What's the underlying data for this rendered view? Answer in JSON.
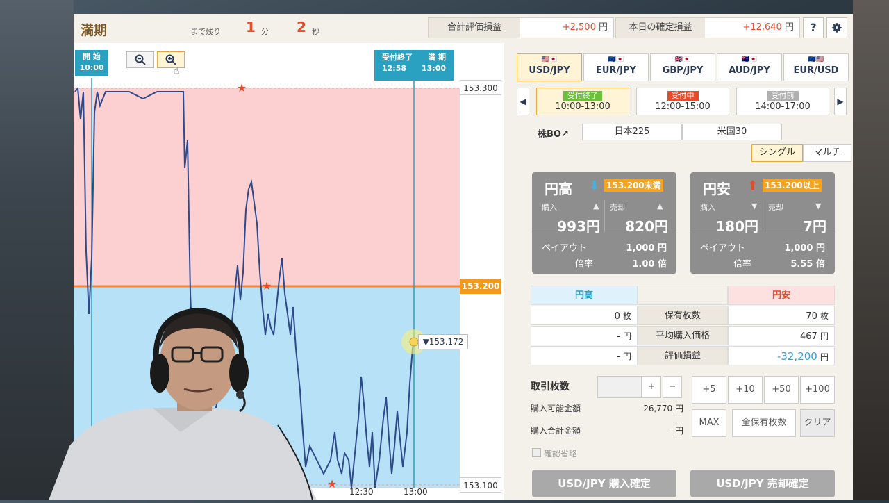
{
  "header": {
    "title": "満期",
    "remaining_label": "まで残り",
    "minutes": "1",
    "minutes_unit": "分",
    "seconds": "2",
    "seconds_unit": "秒",
    "total_pl_label": "合計評価損益",
    "total_pl_value": "+2,500",
    "total_pl_unit": "円",
    "today_pl_label": "本日の確定損益",
    "today_pl_value": "+12,640",
    "today_pl_unit": "円",
    "help_label": "?"
  },
  "chart": {
    "start_label": "開 始",
    "start_time": "10:00",
    "accept_end_label": "受付終了",
    "accept_end_time": "12:58",
    "expiry_label": "満 期",
    "expiry_time": "13:00",
    "upper_price": "153.300",
    "target_price": "153.200",
    "lower_price": "153.100",
    "current_price": "▼153.172",
    "x_tick_1": "12:30",
    "x_tick_2": "13:00",
    "colors": {
      "up_zone": "#fcd0d0",
      "down_zone": "#b6e1f7",
      "line": "#2e4a8c",
      "target": "#f0883a"
    }
  },
  "pairs": [
    {
      "name": "USD/JPY",
      "flags": "🇺🇸🇯🇵",
      "selected": true
    },
    {
      "name": "EUR/JPY",
      "flags": "🇪🇺🇯🇵",
      "selected": false
    },
    {
      "name": "GBP/JPY",
      "flags": "🇬🇧🇯🇵",
      "selected": false
    },
    {
      "name": "AUD/JPY",
      "flags": "🇦🇺🇯🇵",
      "selected": false
    },
    {
      "name": "EUR/USD",
      "flags": "🇪🇺🇺🇸",
      "selected": false
    }
  ],
  "slots": [
    {
      "status": "受付終了",
      "time": "10:00-13:00",
      "color": "#6bbf3a"
    },
    {
      "status": "受付中",
      "time": "12:00-15:00",
      "color": "#e84b2a"
    },
    {
      "status": "受付前",
      "time": "14:00-17:00",
      "color": "#b0b0b0"
    }
  ],
  "stock_bo": {
    "label": "株BO↗",
    "items": [
      "日本225",
      "米国30"
    ]
  },
  "modes": [
    "シングル",
    "マルチ"
  ],
  "options": {
    "high": {
      "title": "円高",
      "arrow": "⬇",
      "condition": "153.200未満",
      "buy_label": "購入",
      "sell_label": "売却",
      "buy_price": "993円",
      "sell_price": "820円",
      "payout_label": "ペイアウト",
      "payout_value": "1,000 円",
      "rate_label": "倍率",
      "rate_value": "1.00 倍"
    },
    "low": {
      "title": "円安",
      "arrow": "⬆",
      "condition": "153.200以上",
      "buy_label": "購入",
      "sell_label": "売却",
      "buy_price": "180円",
      "sell_price": "7円",
      "payout_label": "ペイアウト",
      "payout_value": "1,000 円",
      "rate_label": "倍率",
      "rate_value": "5.55 倍"
    }
  },
  "holdings": {
    "col_high": "円高",
    "col_low": "円安",
    "rows": [
      {
        "label": "保有枚数",
        "high": "0",
        "high_unit": "枚",
        "low": "70",
        "low_unit": "枚"
      },
      {
        "label": "平均購入価格",
        "high": "-",
        "high_unit": "円",
        "low": "467",
        "low_unit": "円"
      },
      {
        "label": "評価損益",
        "high": "-",
        "high_unit": "円",
        "low": "-32,200",
        "low_unit": "円"
      }
    ]
  },
  "trade": {
    "qty_label": "取引枚数",
    "plus": "+",
    "minus": "−",
    "quick": [
      "+5",
      "+10",
      "+50",
      "+100"
    ],
    "max": "MAX",
    "all_held": "全保有枚数",
    "clear": "クリア",
    "available_label": "購入可能金額",
    "available_value": "26,770 円",
    "total_label": "購入合計金額",
    "total_value": "- 円",
    "skip_confirm": "確認省略",
    "buy_confirm": "USD/JPY 購入確定",
    "sell_confirm": "USD/JPY 売却確定"
  }
}
